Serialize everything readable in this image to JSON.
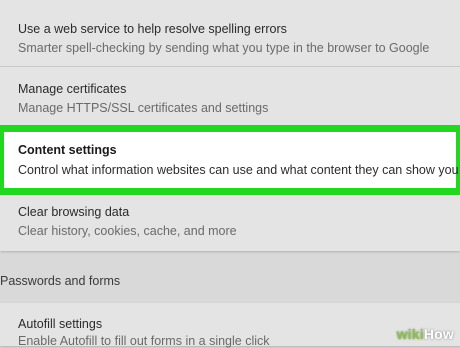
{
  "settings": {
    "items": [
      {
        "title": "Use a web service to help resolve spelling errors",
        "description": "Smarter spell-checking by sending what you type in the browser to Google"
      },
      {
        "title": "Manage certificates",
        "description": "Manage HTTPS/SSL certificates and settings"
      },
      {
        "title": "Content settings",
        "description": "Control what information websites can use and what content they can show you"
      },
      {
        "title": "Clear browsing data",
        "description": "Clear history, cookies, cache, and more"
      }
    ],
    "section_header": "Passwords and forms",
    "autofill": {
      "title": "Autofill settings",
      "description": "Enable Autofill to fill out forms in a single click"
    }
  },
  "watermark": {
    "part1": "wiki",
    "part2": "How"
  },
  "colors": {
    "highlight_border": "#22d81f",
    "background": "#d9d9d9",
    "card": "#e4e4e4"
  }
}
